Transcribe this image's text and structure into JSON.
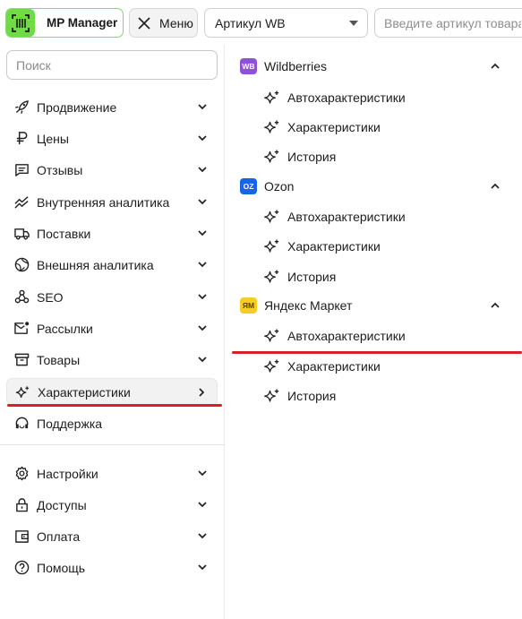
{
  "topbar": {
    "logo_label": "MP Manager",
    "menu_label": "Меню",
    "article_select_value": "Артикул WB",
    "article_input_placeholder": "Введите артикул товара"
  },
  "sidebar": {
    "search_placeholder": "Поиск",
    "items": [
      {
        "label": "Продвижение",
        "icon": "rocket-icon"
      },
      {
        "label": "Цены",
        "icon": "ruble-icon"
      },
      {
        "label": "Отзывы",
        "icon": "message-icon"
      },
      {
        "label": "Внутренняя аналитика",
        "icon": "trend-icon"
      },
      {
        "label": "Поставки",
        "icon": "truck-icon"
      },
      {
        "label": "Внешняя аналитика",
        "icon": "globe-icon"
      },
      {
        "label": "SEO",
        "icon": "seo-icon"
      },
      {
        "label": "Рассылки",
        "icon": "mail-icon"
      },
      {
        "label": "Товары",
        "icon": "box-icon"
      },
      {
        "label": "Характеристики",
        "icon": "sparkle-icon"
      },
      {
        "label": "Поддержка",
        "icon": "headset-icon"
      }
    ],
    "bottom_items": [
      {
        "label": "Настройки",
        "icon": "gear-icon"
      },
      {
        "label": "Доступы",
        "icon": "lock-icon"
      },
      {
        "label": "Оплата",
        "icon": "wallet-icon"
      },
      {
        "label": "Помощь",
        "icon": "help-icon"
      }
    ]
  },
  "marketplaces": [
    {
      "name": "Wildberries",
      "badge": "WB",
      "badge_color": "#8e52d6",
      "items": [
        "Автохарактеристики",
        "Характеристики",
        "История"
      ]
    },
    {
      "name": "Ozon",
      "badge": "OZ",
      "badge_color": "#1565e8",
      "items": [
        "Автохарактеристики",
        "Характеристики",
        "История"
      ]
    },
    {
      "name": "Яндекс Маркет",
      "badge": "ЯМ",
      "badge_color": "#f5cd23",
      "items": [
        "Автохарактеристики",
        "Характеристики",
        "История"
      ]
    }
  ],
  "colors": {
    "highlight_line": "#dc1f26",
    "logo_green": "#6fdc45"
  }
}
